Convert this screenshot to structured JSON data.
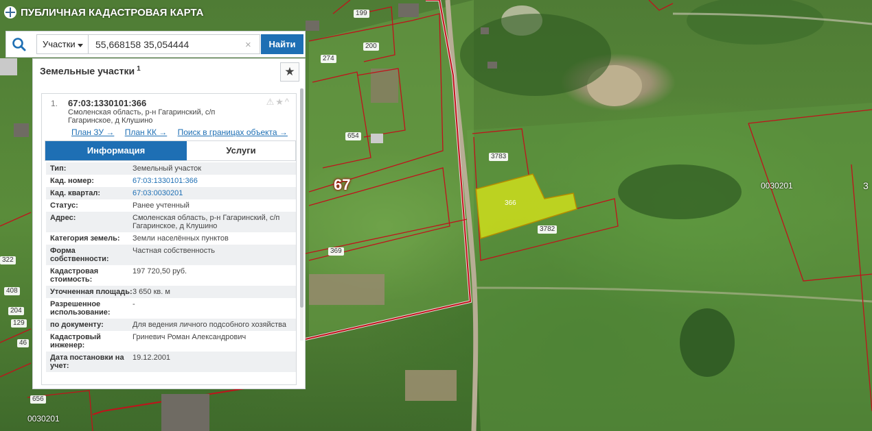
{
  "app": {
    "title": "ПУБЛИЧНАЯ КАДАСТРОВАЯ КАРТА"
  },
  "search": {
    "type_label": "Участки",
    "query": "55,668158 35,054444",
    "clear_symbol": "×",
    "find_label": "Найти"
  },
  "panel": {
    "title": "Земельные участки",
    "count": "1",
    "star_symbol": "★"
  },
  "result": {
    "number": "1.",
    "cadastral_number": "67:03:1330101:366",
    "address_line1": "Смоленская область, р-н Гагаринский, с/п",
    "address_line2": "Гагаринское, д Клушино",
    "tool_icons": "⚠★^",
    "links": [
      "План ЗУ →",
      "План КК →",
      "Поиск в границах объекта →"
    ],
    "tabs": [
      "Информация",
      "Услуги"
    ]
  },
  "info_rows": [
    {
      "key": "Тип:",
      "value": "Земельный участок"
    },
    {
      "key": "Кад. номер:",
      "value": "67:03:1330101:366"
    },
    {
      "key": "Кад. квартал:",
      "value": "67:03:0030201"
    },
    {
      "key": "Статус:",
      "value": "Ранее учтенный"
    },
    {
      "key": "Адрес:",
      "value": "Смоленская область, р-н Гагаринский, с/п Гагаринское, д Клушино"
    },
    {
      "key": "Категория земель:",
      "value": "Земли населённых пунктов"
    },
    {
      "key": "Форма собственности:",
      "value": "Частная собственность"
    },
    {
      "key": "Кадастровая стоимость:",
      "value": "197 720,50 руб."
    },
    {
      "key": "Уточненная площадь:",
      "value": "3 650 кв. м"
    },
    {
      "key": "Разрешенное использование:",
      "value": "-"
    },
    {
      "key": "по документу:",
      "value": "Для ведения личного подсобного хозяйства"
    },
    {
      "key": "Кадастровый инженер:",
      "value": "Гриневич Роман Александрович"
    },
    {
      "key": "Дата постановки на учет:",
      "value": "19.12.2001"
    }
  ],
  "map_labels": {
    "region": "67",
    "parcel_selected": "366",
    "parcels": [
      "199",
      "200",
      "274",
      "654",
      "3783",
      "3782",
      "369",
      "408",
      "204",
      "129",
      "46",
      "656",
      "322"
    ],
    "quarters": [
      "0030201",
      "0030201",
      "3"
    ]
  },
  "colors": {
    "accent": "#1e6fb4",
    "boundary": "#c0121b",
    "selected_fill": "#d4e21a"
  }
}
